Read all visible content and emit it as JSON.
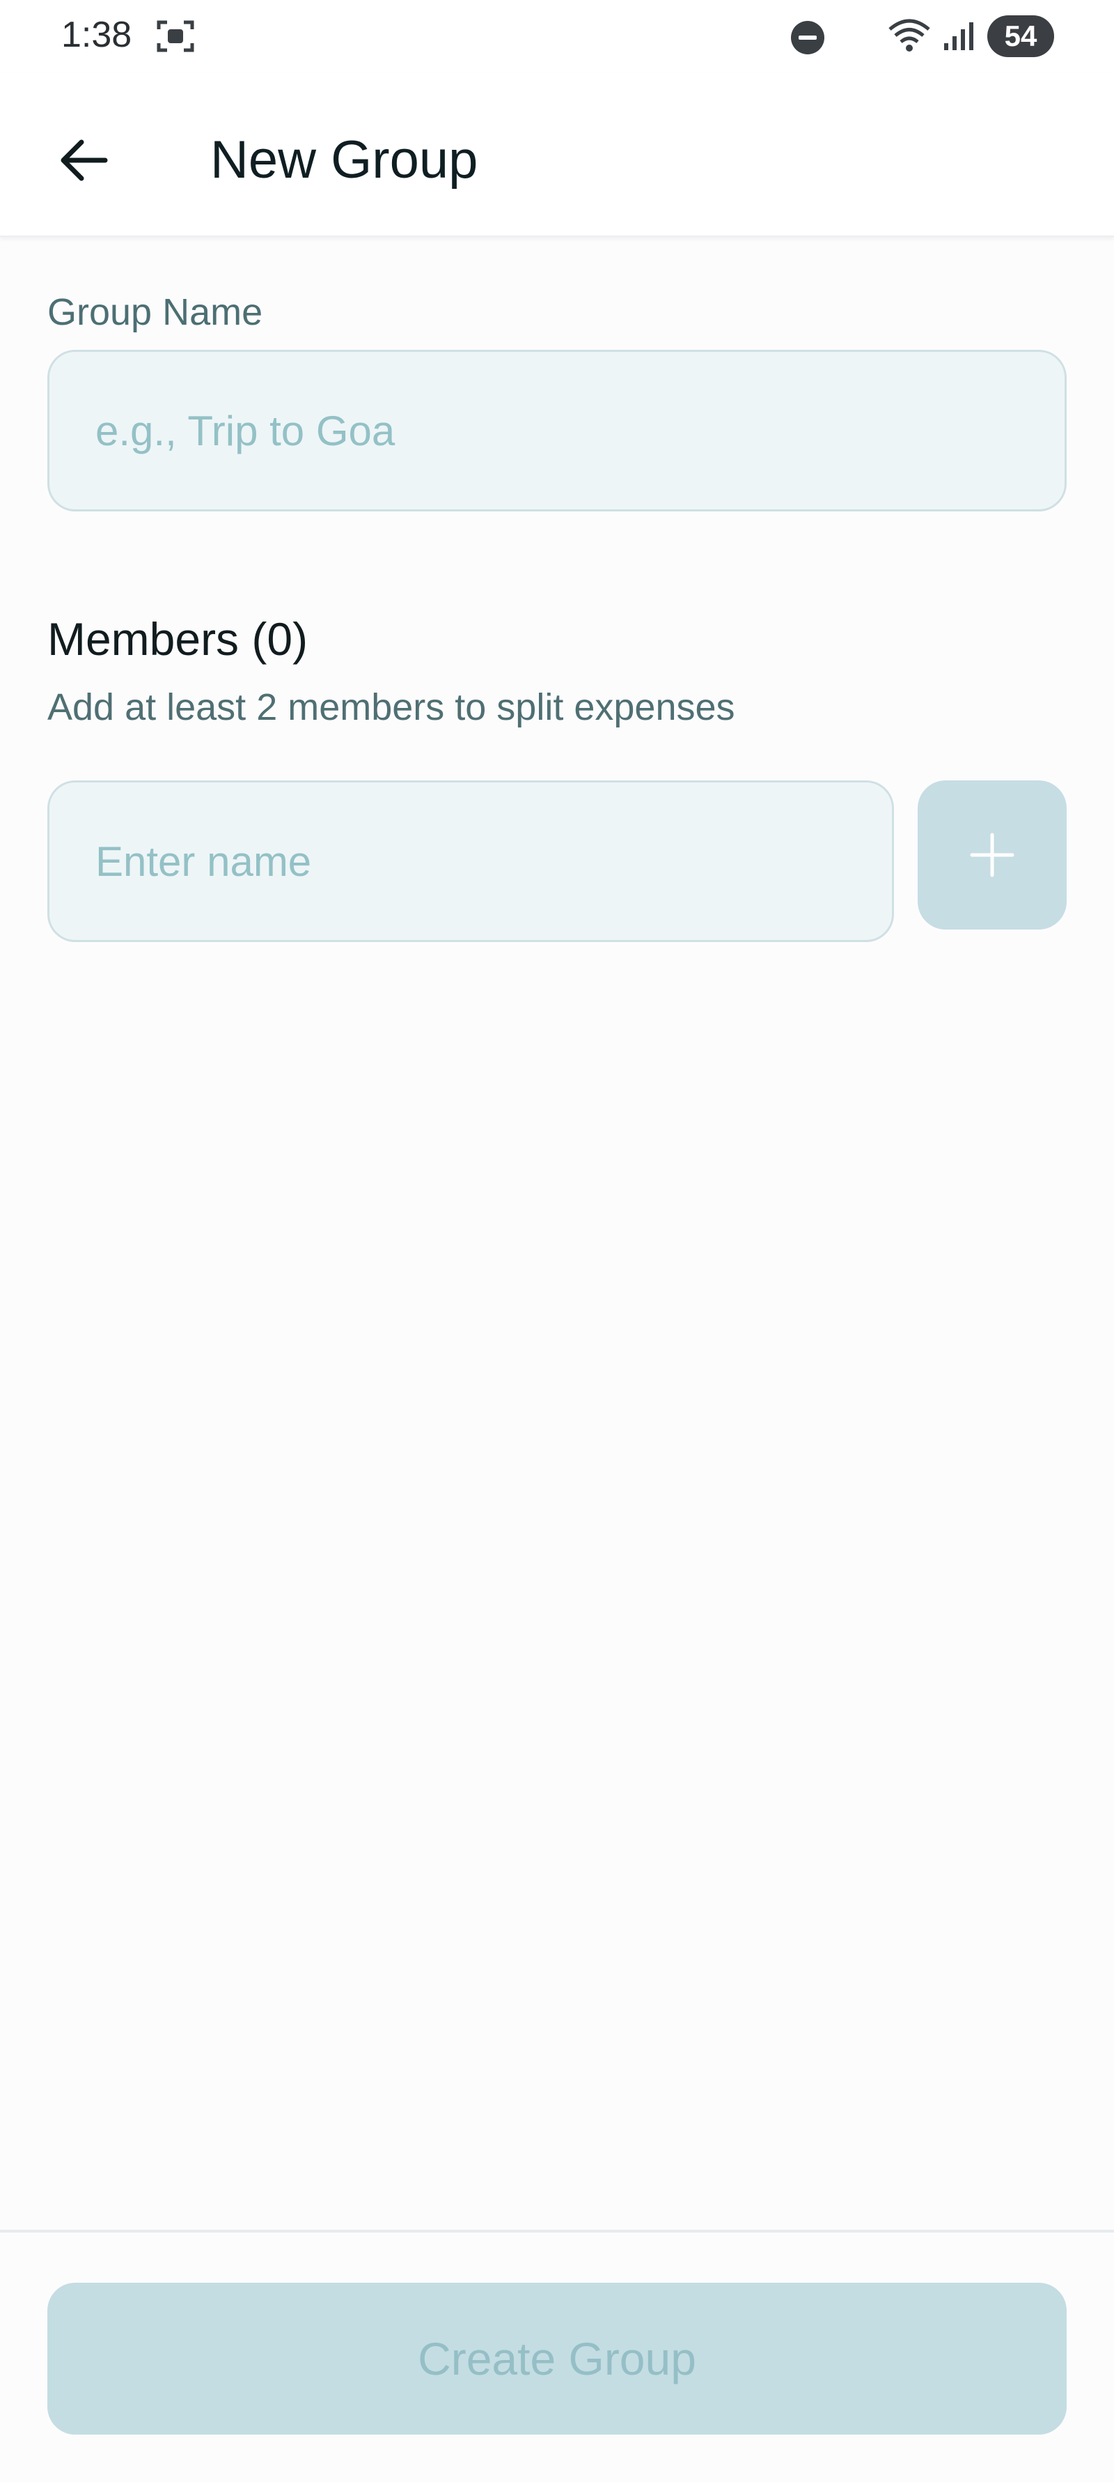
{
  "status_bar": {
    "time": "1:38",
    "battery": "54",
    "icons": [
      "screenshot-icon",
      "do-not-disturb-icon",
      "wifi-icon",
      "signal-icon"
    ]
  },
  "app_bar": {
    "title": "New Group",
    "back_icon": "arrow-left-icon"
  },
  "form": {
    "group_name_label": "Group Name",
    "group_name_placeholder": "e.g., Trip to Goa",
    "group_name_value": "",
    "members_title": "Members (0)",
    "members_hint": "Add at least 2 members to split expenses",
    "member_name_placeholder": "Enter name",
    "member_name_value": "",
    "add_icon": "plus-icon"
  },
  "footer": {
    "create_label": "Create Group"
  },
  "colors": {
    "background": "#fdfcfd",
    "input_fill": "#eef5f7",
    "disabled_button": "#c4dde2",
    "disabled_text": "#95bfc6",
    "label": "#4c6f73"
  }
}
